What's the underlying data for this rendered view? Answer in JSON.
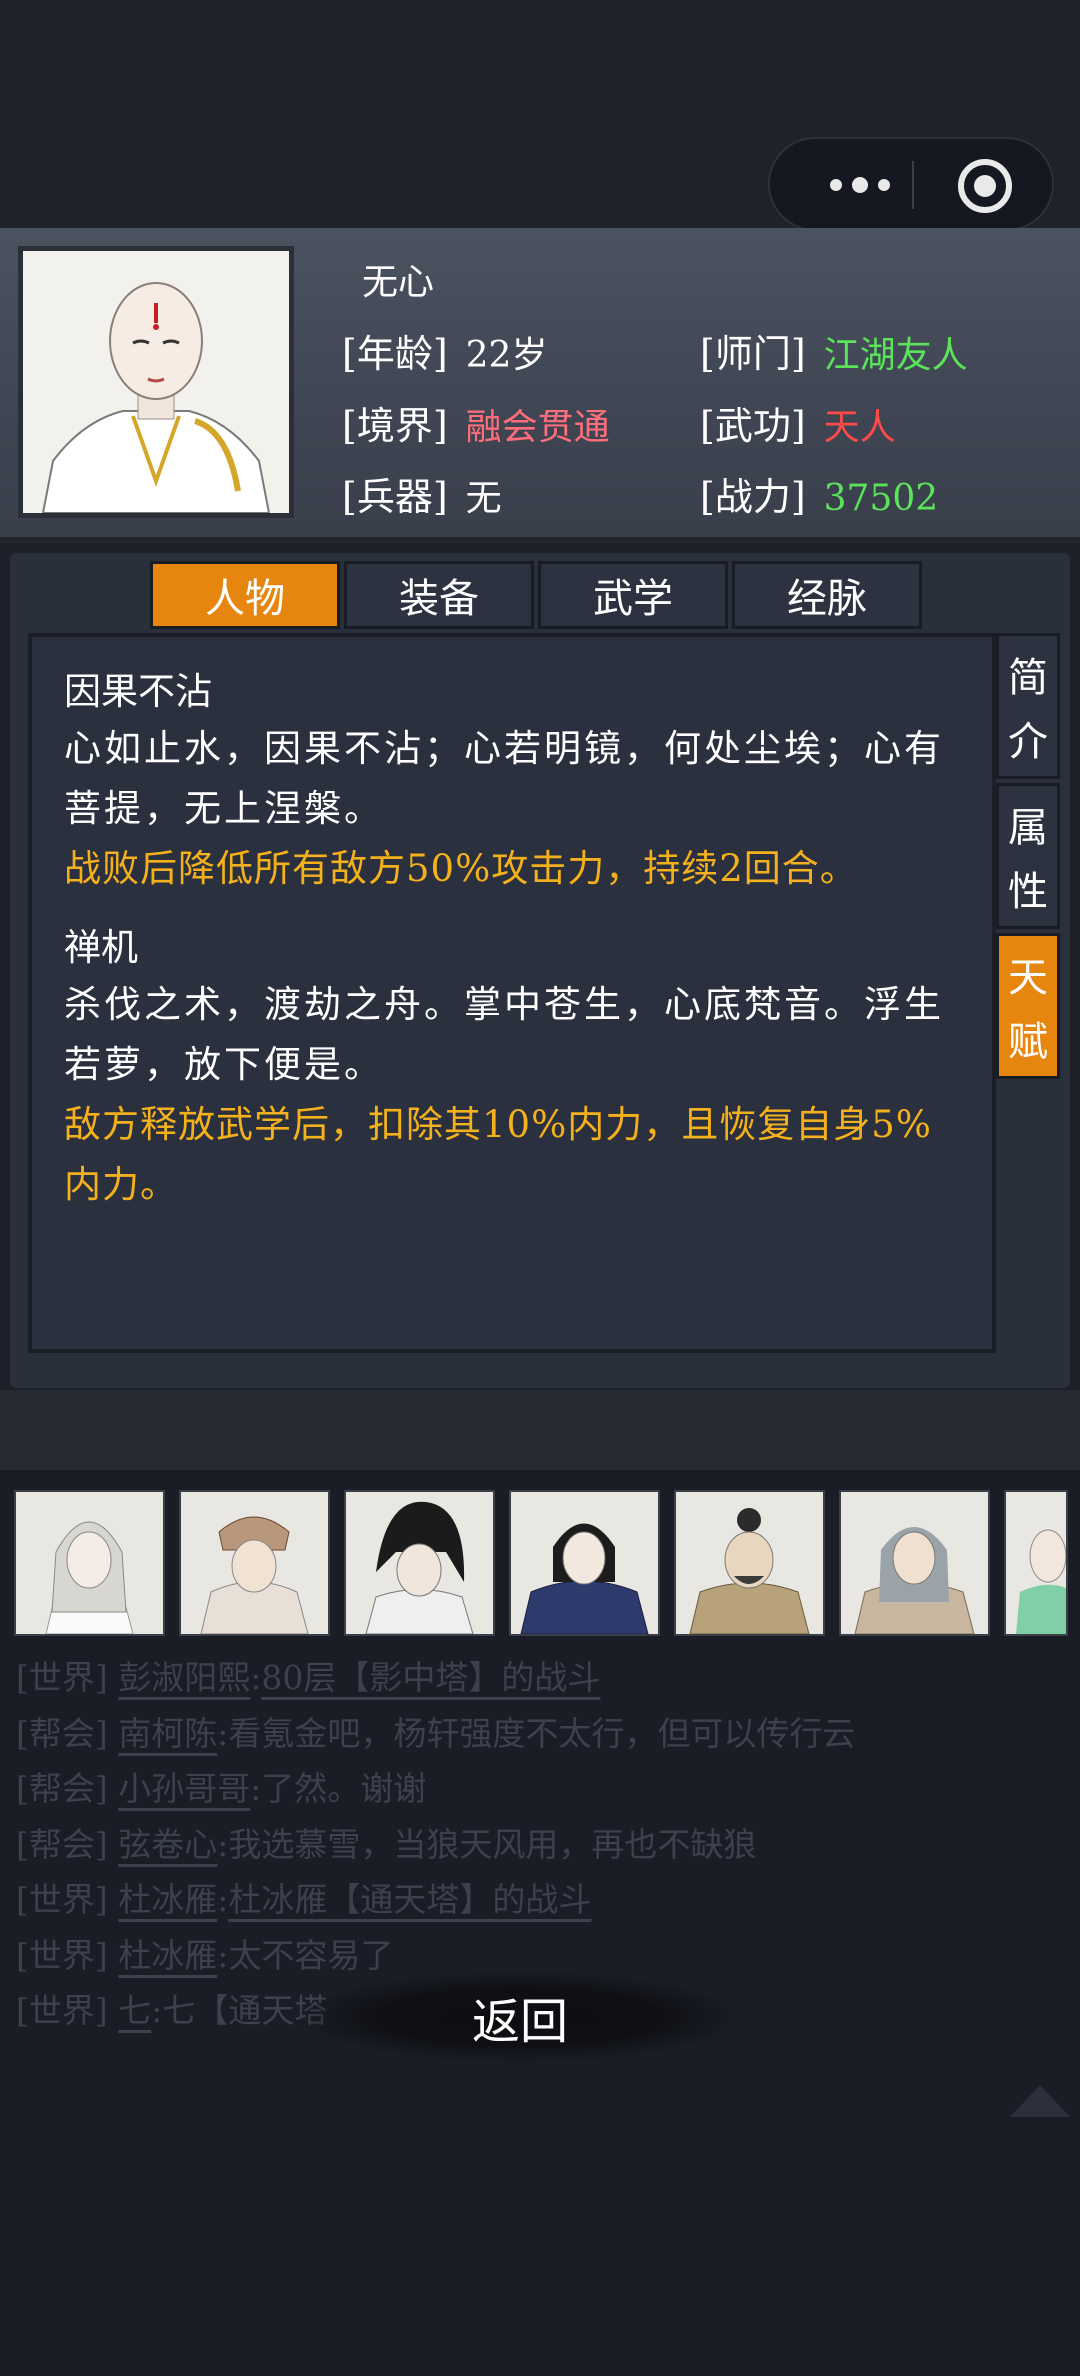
{
  "hero": {
    "name": "无心",
    "stats": [
      {
        "label": "[年龄]",
        "value": "22岁"
      },
      {
        "label": "[师门]",
        "value": "江湖友人"
      },
      {
        "label": "[境界]",
        "value": "融会贯通"
      },
      {
        "label": "[武功]",
        "value": "天人"
      },
      {
        "label": "[兵器]",
        "value": "无"
      },
      {
        "label": "[战力]",
        "value": "37502"
      }
    ]
  },
  "tabs": [
    "人物",
    "装备",
    "武学",
    "经脉"
  ],
  "side_tabs": [
    {
      "c1": "简",
      "c2": "介"
    },
    {
      "c1": "属",
      "c2": "性"
    },
    {
      "c1": "天",
      "c2": "赋"
    }
  ],
  "talents": [
    {
      "title": "因果不沾",
      "desc": "心如止水，因果不沾；心若明镜，何处尘埃；心有菩提，无上涅槃。",
      "effect": "战败后降低所有敌方50%攻击力，持续2回合。"
    },
    {
      "title": "禅机",
      "desc": "杀伐之术，渡劫之舟。掌中苍生，心底梵音。浮生若萝，放下便是。",
      "effect": "敌方释放武学后，扣除其10%内力，且恢复自身5%内力。"
    }
  ],
  "chat": [
    {
      "channel": "[世界]",
      "user": "彭淑阳熙",
      "text": "80层【影中塔】的战斗"
    },
    {
      "channel": "[帮会]",
      "user": "南柯陈",
      "text": "看氪金吧，杨轩强度不太行，但可以传行云"
    },
    {
      "channel": "[帮会]",
      "user": "小孙哥哥",
      "text": "了然。谢谢"
    },
    {
      "channel": "[帮会]",
      "user": "弦卷心",
      "text": "我选慕雪，当狼天风用，再也不缺狼"
    },
    {
      "channel": "[世界]",
      "user": "杜冰雁",
      "text": "杜冰雁【通天塔】的战斗"
    },
    {
      "channel": "[世界]",
      "user": "杜冰雁",
      "text": "太不容易了"
    },
    {
      "channel": "[世界]",
      "user": "七",
      "text": "七【通天塔"
    }
  ],
  "back_label": "返回",
  "colors": {
    "accent_orange": "#e6860e",
    "effect_gold": "#f4b11c",
    "value_green": "#5be35a",
    "value_red": "#ff4a4a",
    "value_pink": "#ff6e7a"
  }
}
